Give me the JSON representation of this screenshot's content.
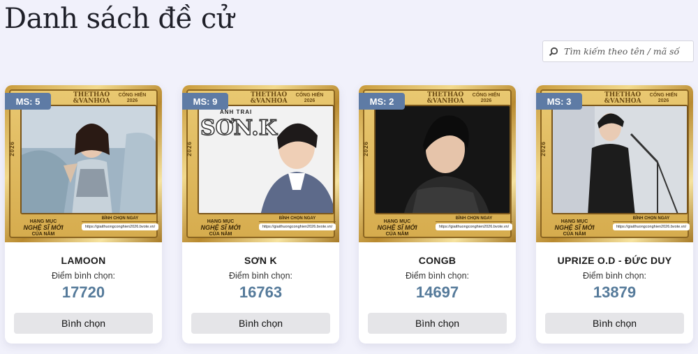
{
  "page": {
    "title": "Danh sách đề cử",
    "search_placeholder": "Tìm kiếm theo tên / mã số"
  },
  "poster_common": {
    "logo_left_line1": "THETHAO",
    "logo_left_line2": "&VANHOA",
    "logo_right_line1": "CỐNG HIẾN",
    "logo_right_line2": "2026",
    "year_vertical": "2026",
    "category_small": "HẠNG MỤC",
    "category_main": "NGHỆ SĨ MỚI",
    "category_sub": "CỦA NĂM",
    "vote_now": "BÌNH CHỌN NGAY",
    "url": "https://giaithuongconghien2026.bvote.vn/"
  },
  "colors": {
    "badge": "#5e7ba5",
    "score": "#557a9a",
    "gold": "#d6ac4e"
  },
  "candidates": [
    {
      "code_badge": "MS: 5",
      "name": "LAMOON",
      "score_label": "Điểm bình chọn:",
      "score": "17720",
      "button": "Bình chọn"
    },
    {
      "code_badge": "MS: 9",
      "name": "SƠN K",
      "score_label": "Điểm bình chọn:",
      "score": "16763",
      "button": "Bình chọn",
      "poster_text": "ANH TRAI",
      "poster_logo": "SƠN.K"
    },
    {
      "code_badge": "MS: 2",
      "name": "CONGB",
      "score_label": "Điểm bình chọn:",
      "score": "14697",
      "button": "Bình chọn"
    },
    {
      "code_badge": "MS: 3",
      "name": "UPRIZE O.D - ĐỨC DUY",
      "score_label": "Điểm bình chọn:",
      "score": "13879",
      "button": "Bình chọn"
    }
  ]
}
